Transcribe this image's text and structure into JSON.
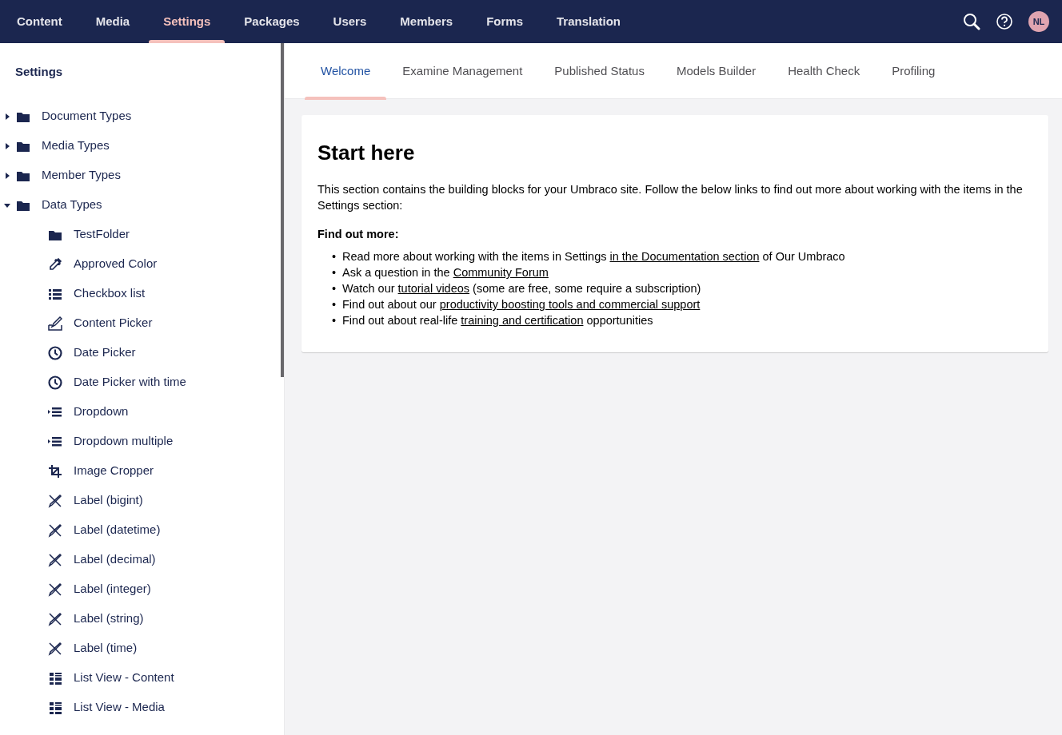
{
  "top_nav": {
    "sections": [
      {
        "label": "Content",
        "selected": false
      },
      {
        "label": "Media",
        "selected": false
      },
      {
        "label": "Settings",
        "selected": true
      },
      {
        "label": "Packages",
        "selected": false
      },
      {
        "label": "Users",
        "selected": false
      },
      {
        "label": "Members",
        "selected": false
      },
      {
        "label": "Forms",
        "selected": false
      },
      {
        "label": "Translation",
        "selected": false
      }
    ],
    "avatar": "NL"
  },
  "sidebar": {
    "title": "Settings",
    "tree": [
      {
        "label": "Document Types",
        "kind": "folder",
        "expanded": false
      },
      {
        "label": "Media Types",
        "kind": "folder",
        "expanded": false
      },
      {
        "label": "Member Types",
        "kind": "folder",
        "expanded": false
      },
      {
        "label": "Data Types",
        "kind": "folder",
        "expanded": true,
        "children": [
          {
            "label": "TestFolder",
            "kind": "folder"
          },
          {
            "label": "Approved Color",
            "kind": "dropper"
          },
          {
            "label": "Checkbox list",
            "kind": "list"
          },
          {
            "label": "Content Picker",
            "kind": "signature"
          },
          {
            "label": "Date Picker",
            "kind": "clock"
          },
          {
            "label": "Date Picker with time",
            "kind": "clock"
          },
          {
            "label": "Dropdown",
            "kind": "dropdown"
          },
          {
            "label": "Dropdown multiple",
            "kind": "dropdown"
          },
          {
            "label": "Image Cropper",
            "kind": "crop"
          },
          {
            "label": "Label (bigint)",
            "kind": "label"
          },
          {
            "label": "Label (datetime)",
            "kind": "label"
          },
          {
            "label": "Label (decimal)",
            "kind": "label"
          },
          {
            "label": "Label (integer)",
            "kind": "label"
          },
          {
            "label": "Label (string)",
            "kind": "label"
          },
          {
            "label": "Label (time)",
            "kind": "label"
          },
          {
            "label": "List View - Content",
            "kind": "grid"
          },
          {
            "label": "List View - Media",
            "kind": "grid"
          }
        ]
      }
    ]
  },
  "tabs": [
    {
      "label": "Welcome",
      "selected": true
    },
    {
      "label": "Examine Management",
      "selected": false
    },
    {
      "label": "Published Status",
      "selected": false
    },
    {
      "label": "Models Builder",
      "selected": false
    },
    {
      "label": "Health Check",
      "selected": false
    },
    {
      "label": "Profiling",
      "selected": false
    }
  ],
  "welcome": {
    "heading": "Start here",
    "intro": "This section contains the building blocks for your Umbraco site. Follow the below links to find out more about working with the items in the Settings section:",
    "subheading": "Find out more:",
    "links": [
      {
        "marker": "•",
        "before": "Read more about working with the items in Settings ",
        "link": "in the Documentation section",
        "after": " of Our Umbraco"
      },
      {
        "marker": "•",
        "before": "Ask a question in the ",
        "link": "Community Forum"
      },
      {
        "marker": "•",
        "before": "Watch our ",
        "link": "tutorial videos",
        "after": " (some are free, some require a subscription)"
      },
      {
        "marker": "•",
        "before": "Find out about our ",
        "link": "productivity boosting tools and commercial support"
      },
      {
        "marker": "•",
        "before": "Find out about real-life ",
        "link": "training and certification",
        "after": " opportunities"
      }
    ]
  }
}
